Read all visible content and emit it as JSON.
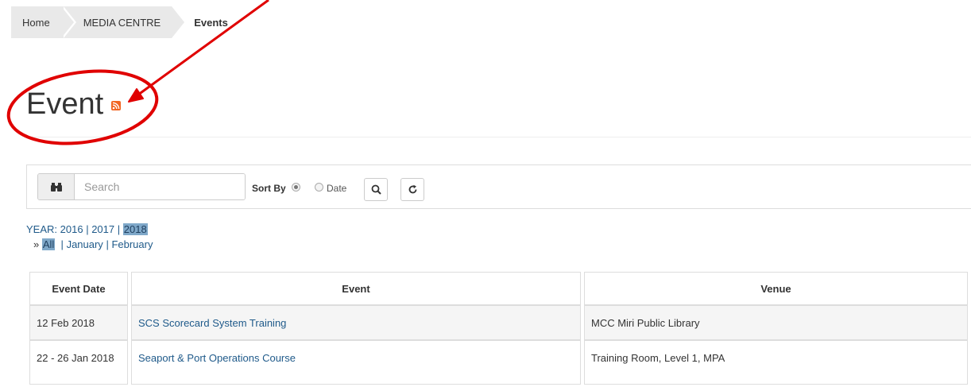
{
  "breadcrumb": {
    "home": "Home",
    "media": "MEDIA CENTRE",
    "current": "Events"
  },
  "page": {
    "title": "Event",
    "rss_icon": "rss-icon"
  },
  "search": {
    "placeholder": "Search",
    "value": "",
    "sort_label": "Sort By",
    "sort_options": [
      "",
      "Date"
    ],
    "selected_sort_index": 0,
    "search_icon": "binoculars-icon",
    "submit_icon": "magnifier-icon",
    "reset_icon": "refresh-icon"
  },
  "filters": {
    "year_label": "YEAR:",
    "years": [
      "2016",
      "2017",
      "2018"
    ],
    "selected_year": "2018",
    "month_prefix": "»",
    "months": [
      "All",
      "January",
      "February"
    ],
    "selected_month": "All"
  },
  "table": {
    "headers": [
      "Event Date",
      "Event",
      "Venue"
    ],
    "rows": [
      {
        "date": "12 Feb 2018",
        "event": "SCS Scorecard System Training",
        "venue": "MCC Miri Public Library"
      },
      {
        "date": "22 - 26 Jan 2018",
        "event": "Seaport & Port Operations Course",
        "venue": "Training Room, Level 1, MPA"
      }
    ]
  },
  "colors": {
    "annotation": "#e00000",
    "link": "#1f5a8a",
    "rss": "#f26522",
    "highlight": "#7fa8c9"
  }
}
